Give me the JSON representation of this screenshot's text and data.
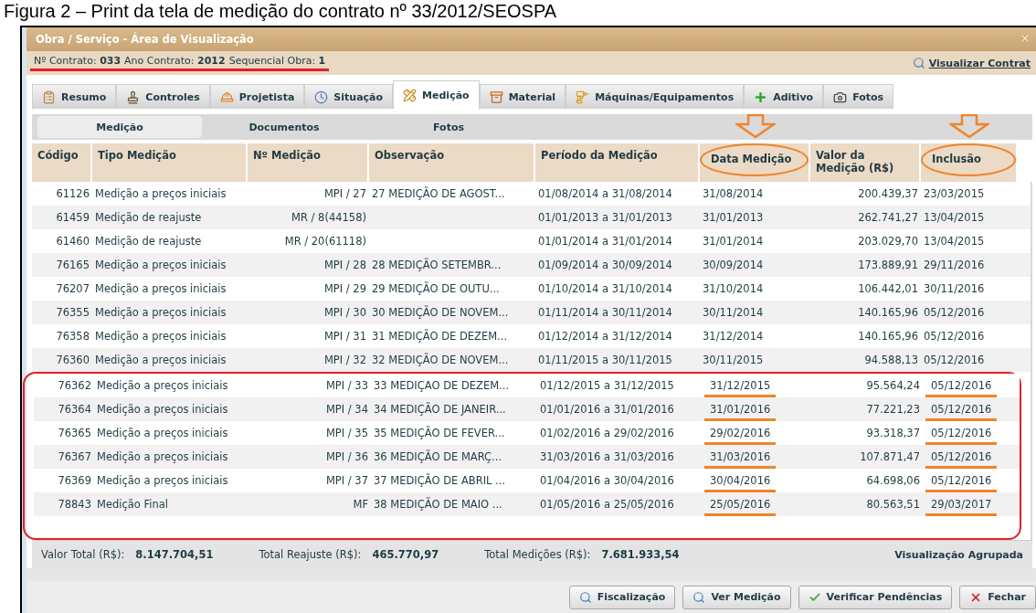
{
  "caption": "Figura 2 – Print da tela de medição do contrato nº 33/2012/SEOSPA",
  "window": {
    "title": "Obra / Serviço - Área de Visualização"
  },
  "info": {
    "underlined": true,
    "fields": [
      {
        "label": "Nº Contrato:",
        "value": "033"
      },
      {
        "label": "Ano Contrato:",
        "value": "2012"
      },
      {
        "label": "Sequencial Obra:",
        "value": "1"
      }
    ],
    "link": "Visualizar Contrat"
  },
  "tabs": [
    {
      "label": "Resumo",
      "kind": "clipboard",
      "selected": false
    },
    {
      "label": "Controles",
      "kind": "stamp",
      "selected": false
    },
    {
      "label": "Projetista",
      "kind": "worker",
      "selected": false
    },
    {
      "label": "Situação",
      "kind": "clock",
      "selected": false
    },
    {
      "label": "Medição",
      "kind": "ruler",
      "selected": true
    },
    {
      "label": "Material",
      "kind": "box",
      "selected": false
    },
    {
      "label": "Máquinas/Equipamentos",
      "kind": "drill",
      "selected": false
    },
    {
      "label": "Aditivo",
      "kind": "plus",
      "selected": false
    },
    {
      "label": "Fotos",
      "kind": "camera",
      "selected": false
    }
  ],
  "subtabs": [
    {
      "label": "Medição",
      "selected": true
    },
    {
      "label": "Documentos",
      "selected": false
    },
    {
      "label": "Fotos",
      "selected": false
    }
  ],
  "table": {
    "columns": [
      {
        "label": "Código",
        "circled": false
      },
      {
        "label": "Tipo Medição",
        "circled": false
      },
      {
        "label": "Nº Medição",
        "circled": false
      },
      {
        "label": "Observação",
        "circled": false
      },
      {
        "label": "Período da Medição",
        "circled": false
      },
      {
        "label": "Data Medição",
        "circled": true
      },
      {
        "label": "Valor da Medição (R$)",
        "circled": false
      },
      {
        "label": "Inclusão",
        "circled": true
      }
    ],
    "rows": [
      {
        "cells": [
          "61126",
          "Medição a preços iniciais",
          "MPI / 27",
          "27 MEDIÇÃO DE AGOST...",
          "01/08/2014 a 31/08/2014",
          "31/08/2014",
          "200.439,37",
          "23/03/2015"
        ],
        "boxed": false,
        "underlined": false
      },
      {
        "cells": [
          "61459",
          "Medição de reajuste",
          "MR / 8(44158)",
          "",
          "01/01/2013 a 31/01/2013",
          "31/01/2013",
          "262.741,27",
          "13/04/2015"
        ],
        "boxed": false,
        "underlined": false
      },
      {
        "cells": [
          "61460",
          "Medição de reajuste",
          "MR / 20(61118)",
          "",
          "01/01/2014 a 31/01/2014",
          "31/01/2014",
          "203.029,70",
          "13/04/2015"
        ],
        "boxed": false,
        "underlined": false
      },
      {
        "cells": [
          "76165",
          "Medição a preços iniciais",
          "MPI / 28",
          "28 MEDIÇÃO SETEMBR...",
          "01/09/2014 a 30/09/2014",
          "30/09/2014",
          "173.889,91",
          "29/11/2016"
        ],
        "boxed": false,
        "underlined": false
      },
      {
        "cells": [
          "76207",
          "Medição a preços iniciais",
          "MPI / 29",
          "29 MEDIÇÃO DE OUTU...",
          "01/10/2014 a 31/10/2014",
          "31/10/2014",
          "106.442,01",
          "30/11/2016"
        ],
        "boxed": false,
        "underlined": false
      },
      {
        "cells": [
          "76355",
          "Medição a preços iniciais",
          "MPI / 30",
          "30 MEDIÇÃO DE NOVEM...",
          "01/11/2014 a 30/11/2014",
          "30/11/2014",
          "140.165,96",
          "05/12/2016"
        ],
        "boxed": false,
        "underlined": false
      },
      {
        "cells": [
          "76358",
          "Medição a preços iniciais",
          "MPI / 31",
          "31 MEDIÇÃO DE DEZEM...",
          "01/12/2014 a 31/12/2014",
          "31/12/2014",
          "140.165,96",
          "05/12/2016"
        ],
        "boxed": false,
        "underlined": false
      },
      {
        "cells": [
          "76360",
          "Medição a preços iniciais",
          "MPI / 32",
          "32 MEDIÇÃO DE NOVEM...",
          "01/11/2015 a 30/11/2015",
          "30/11/2015",
          "94.588,13",
          "05/12/2016"
        ],
        "boxed": false,
        "underlined": false
      },
      {
        "cells": [
          "76362",
          "Medição a preços iniciais",
          "MPI / 33",
          "33 MEDIÇAO DE DEZEM...",
          "01/12/2015 a 31/12/2015",
          "31/12/2015",
          "95.564,24",
          "05/12/2016"
        ],
        "boxed": true,
        "underlined": true
      },
      {
        "cells": [
          "76364",
          "Medição a preços iniciais",
          "MPI / 34",
          "34 MEDIÇÃO DE JANEIR...",
          "01/01/2016 a 31/01/2016",
          "31/01/2016",
          "77.221,23",
          "05/12/2016"
        ],
        "boxed": true,
        "underlined": true
      },
      {
        "cells": [
          "76365",
          "Medição a preços iniciais",
          "MPI / 35",
          "35 MEDIÇÃO DE FEVER...",
          "01/02/2016 a 29/02/2016",
          "29/02/2016",
          "93.318,37",
          "05/12/2016"
        ],
        "boxed": true,
        "underlined": true
      },
      {
        "cells": [
          "76367",
          "Medição a preços iniciais",
          "MPI / 36",
          "36 MEDIÇÃO DE MARÇ...",
          "31/03/2016 a 31/03/2016",
          "31/03/2016",
          "107.871,47",
          "05/12/2016"
        ],
        "boxed": true,
        "underlined": true
      },
      {
        "cells": [
          "76369",
          "Medição a preços iniciais",
          "MPI / 37",
          "37 MEDIÇÃO DE ABRIL ...",
          "01/04/2016 a 30/04/2016",
          "30/04/2016",
          "64.698,06",
          "05/12/2016"
        ],
        "boxed": true,
        "underlined": true
      },
      {
        "cells": [
          "78843",
          "Medição Final",
          "MF",
          "38 MEDIÇÃO DE MAIO ...",
          "01/05/2016 a 25/05/2016",
          "25/05/2016",
          "80.563,51",
          "29/03/2017"
        ],
        "boxed": true,
        "underlined": true
      }
    ]
  },
  "totals": [
    {
      "label": "Valor Total (R$):",
      "value": "8.147.704,51"
    },
    {
      "label": "Total Reajuste (R$):",
      "value": "465.770,97"
    },
    {
      "label": "Total Medições (R$):",
      "value": "7.681.933,54"
    }
  ],
  "grouped_view": "Visualização Agrupada",
  "buttons": [
    {
      "label": "Fiscalização",
      "kind": "search"
    },
    {
      "label": "Ver Medição",
      "kind": "search"
    },
    {
      "label": "Verificar Pendências",
      "kind": "check"
    },
    {
      "label": "Fechar",
      "kind": "close"
    }
  ]
}
